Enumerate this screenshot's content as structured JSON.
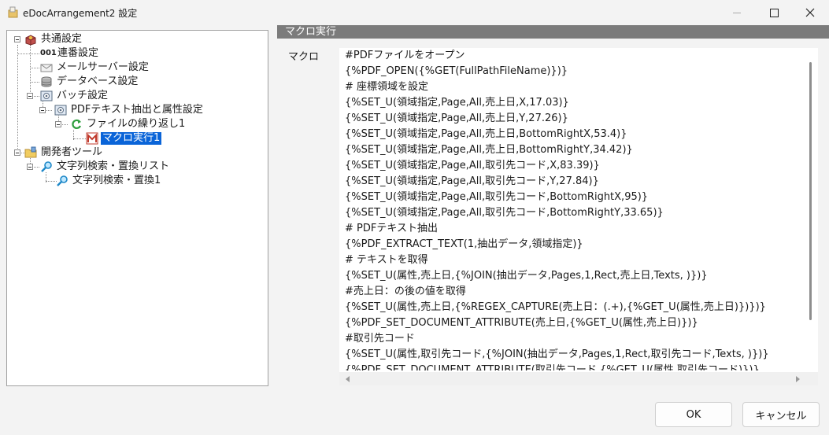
{
  "window": {
    "title": "eDocArrangement2 設定"
  },
  "tree": {
    "items": [
      {
        "label": "共通設定",
        "icon": "settings-box-icon"
      },
      {
        "label": "連番設定",
        "icon": "number-001-icon",
        "icon_text": "001"
      },
      {
        "label": "メールサーバー設定",
        "icon": "mail-icon"
      },
      {
        "label": "データベース設定",
        "icon": "database-icon"
      },
      {
        "label": "バッチ設定",
        "icon": "batch-icon"
      },
      {
        "label": "PDFテキスト抽出と属性設定",
        "icon": "pdf-batch-icon"
      },
      {
        "label": "ファイルの繰り返し1",
        "icon": "loop-icon"
      },
      {
        "label": "マクロ実行1",
        "icon": "macro-icon",
        "selected": true
      },
      {
        "label": "開発者ツール",
        "icon": "folder-tools-icon"
      },
      {
        "label": "文字列検索・置換リスト",
        "icon": "search-replace-icon"
      },
      {
        "label": "文字列検索・置換1",
        "icon": "search-replace-icon"
      }
    ]
  },
  "section": {
    "header": "マクロ実行",
    "field_label": "マクロ"
  },
  "macro": {
    "lines": [
      "#PDFファイルをオープン",
      "{%PDF_OPEN({%GET(FullPathFileName)})}",
      "# 座標領域を設定",
      "{%SET_U(領域指定,Page,All,売上日,X,17.03)}",
      "{%SET_U(領域指定,Page,All,売上日,Y,27.26)}",
      "{%SET_U(領域指定,Page,All,売上日,BottomRightX,53.4)}",
      "{%SET_U(領域指定,Page,All,売上日,BottomRightY,34.42)}",
      "{%SET_U(領域指定,Page,All,取引先コード,X,83.39)}",
      "{%SET_U(領域指定,Page,All,取引先コード,Y,27.84)}",
      "{%SET_U(領域指定,Page,All,取引先コード,BottomRightX,95)}",
      "{%SET_U(領域指定,Page,All,取引先コード,BottomRightY,33.65)}",
      "# PDFテキスト抽出",
      "{%PDF_EXTRACT_TEXT(1,抽出データ,領域指定)}",
      "# テキストを取得",
      "{%SET_U(属性,売上日,{%JOIN(抽出データ,Pages,1,Rect,売上日,Texts, )})}",
      "#売上日：の後の値を取得",
      "{%SET_U(属性,売上日,{%REGEX_CAPTURE(売上日：(.+),{%GET_U(属性,売上日)})})}",
      "{%PDF_SET_DOCUMENT_ATTRIBUTE(売上日,{%GET_U(属性,売上日)})}",
      "#取引先コード",
      "{%SET_U(属性,取引先コード,{%JOIN(抽出データ,Pages,1,Rect,取引先コード,Texts, )})}",
      "{%PDF_SET_DOCUMENT_ATTRIBUTE(取引先コード,{%GET_U(属性,取引先コード)})}"
    ]
  },
  "buttons": {
    "ok": "OK",
    "cancel": "キャンセル"
  },
  "colors": {
    "selection": "#0a64d8",
    "section_header_bg": "#7b7b7b"
  }
}
